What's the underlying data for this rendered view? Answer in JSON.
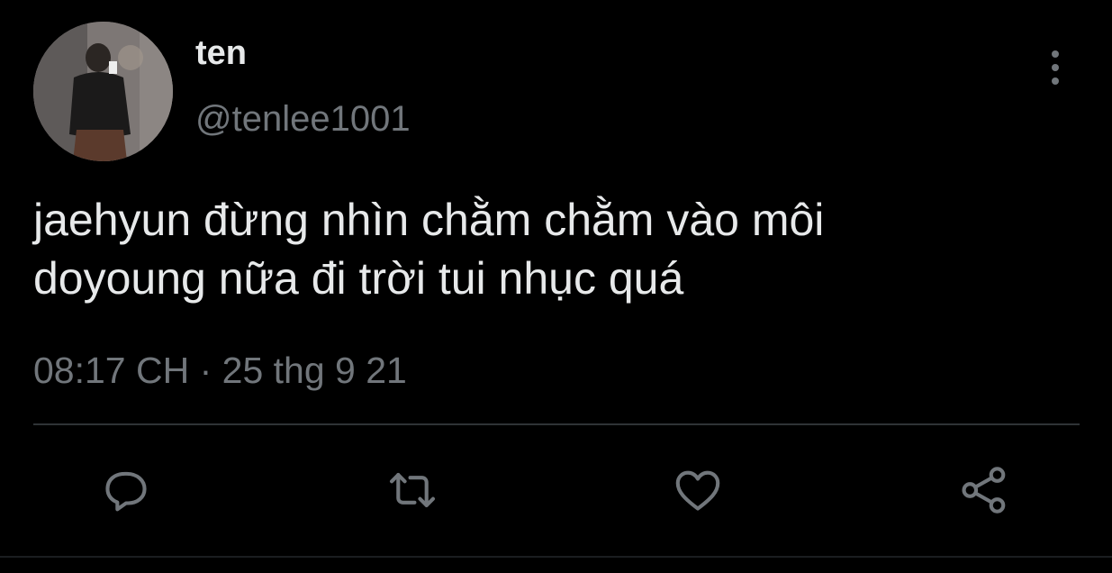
{
  "tweet": {
    "author": {
      "display_name": "ten",
      "handle": "@tenlee1001"
    },
    "text_lines": [
      "jaehyun đừng nhìn chằm chằm vào môi",
      "doyoung nữa đi trời tui nhục quá"
    ],
    "timestamp": "08:17 CH · 25 thg 9 21"
  },
  "actions": {
    "reply_icon": "reply-icon",
    "retweet_icon": "retweet-icon",
    "like_icon": "heart-icon",
    "share_icon": "share-icon",
    "more_icon": "more-vertical-icon"
  },
  "colors": {
    "background": "#000000",
    "primary_text": "#e7e9ea",
    "secondary_text": "#71767b",
    "icon": "#71767b",
    "divider": "#2f3336"
  }
}
